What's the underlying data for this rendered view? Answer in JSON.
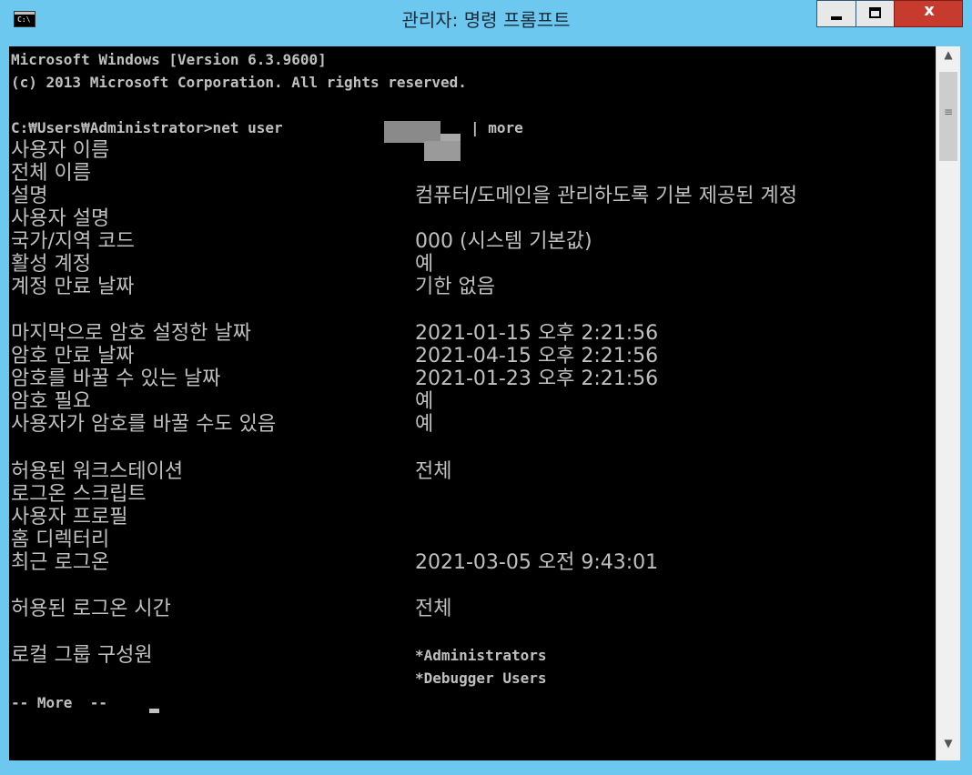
{
  "window": {
    "title": "관리자: 명령 프롬프트",
    "icon_label": "C:\\",
    "close_label": "x"
  },
  "console": {
    "header": [
      "Microsoft Windows [Version 6.3.9600]",
      "(c) 2013 Microsoft Corporation. All rights reserved."
    ],
    "prompt": "C:₩Users₩Administrator>net user",
    "pipe_cmd": "| more",
    "rows": [
      {
        "label": "사용자 이름",
        "value": ""
      },
      {
        "label": "전체 이름",
        "value": ""
      },
      {
        "label": "설명",
        "value": "컴퓨터/도메인을 관리하도록 기본 제공된 계정"
      },
      {
        "label": "사용자 설명",
        "value": ""
      },
      {
        "label": "국가/지역 코드",
        "value": "000 (시스템 기본값)"
      },
      {
        "label": "활성 계정",
        "value": "예"
      },
      {
        "label": "계정 만료 날짜",
        "value": "기한 없음"
      },
      {
        "label": "마지막으로 암호 설정한 날짜",
        "value": "2021-01-15 오후 2:21:56"
      },
      {
        "label": "암호 만료 날짜",
        "value": "2021-04-15 오후 2:21:56"
      },
      {
        "label": "암호를 바꿀 수 있는 날짜",
        "value": "2021-01-23 오후 2:21:56"
      },
      {
        "label": "암호 필요",
        "value": "예"
      },
      {
        "label": "사용자가 암호를 바꿀 수도 있음",
        "value": "예"
      },
      {
        "label": "허용된 워크스테이션",
        "value": "전체"
      },
      {
        "label": "로그온 스크립트",
        "value": ""
      },
      {
        "label": "사용자 프로필",
        "value": ""
      },
      {
        "label": "홈 디렉터리",
        "value": ""
      },
      {
        "label": "최근 로그온",
        "value": "2021-03-05 오전 9:43:01"
      },
      {
        "label": "허용된 로그온 시간",
        "value": "전체"
      },
      {
        "label": "로컬 그룹 구성원",
        "value": "*Administrators"
      },
      {
        "label": "",
        "value": "*Debugger Users"
      }
    ],
    "more_prompt": "-- More  --"
  },
  "scrollbar": {
    "up_icon": "chevron-up-icon",
    "down_icon": "chevron-down-icon"
  }
}
